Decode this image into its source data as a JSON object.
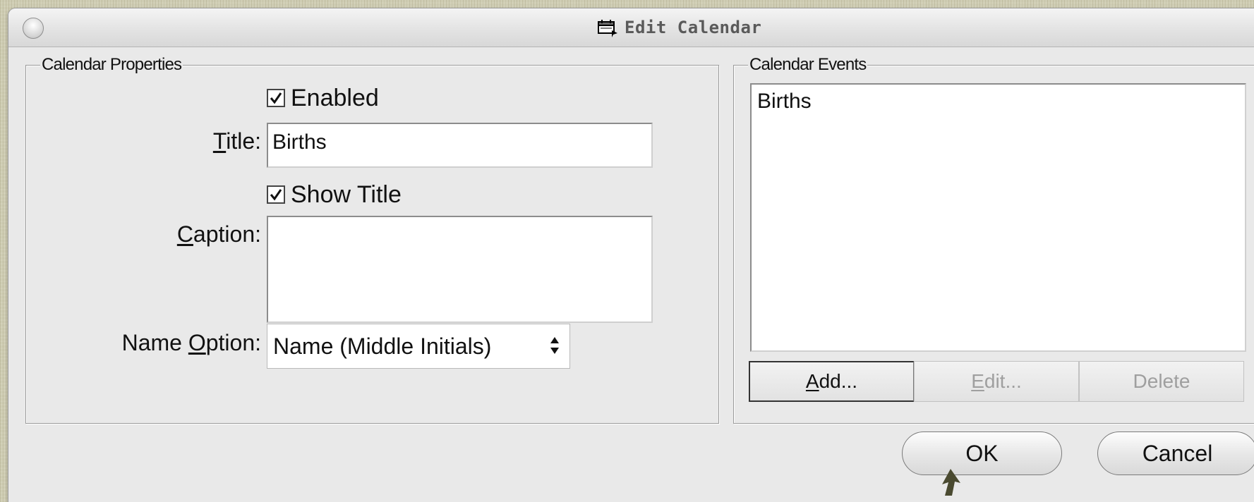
{
  "window": {
    "title": "Edit Calendar",
    "title_icon": "calendar-icon"
  },
  "properties": {
    "group_label": "Calendar Properties",
    "enabled": {
      "label": "Enabled",
      "checked": true
    },
    "title_field": {
      "label_accel": "T",
      "label_rest": "itle:",
      "value": "Births"
    },
    "show_title": {
      "label": "Show Title",
      "checked": true
    },
    "caption_field": {
      "label_accel": "C",
      "label_rest": "aption:",
      "value": ""
    },
    "name_option": {
      "label_pre": "Name ",
      "label_accel": "O",
      "label_rest": "ption:",
      "selected": "Name (Middle Initials)"
    }
  },
  "events": {
    "group_label": "Calendar Events",
    "items": [
      "Births"
    ],
    "add_accel": "A",
    "add_rest": "dd...",
    "edit_accel": "E",
    "edit_rest": "dit...",
    "delete_label": "Delete"
  },
  "footer": {
    "ok_label": "OK",
    "cancel_label": "Cancel"
  },
  "colors": {
    "desktop": "#cfcdb4",
    "window_bg": "#e9e9e9",
    "disabled_text": "#9f9f9f"
  }
}
